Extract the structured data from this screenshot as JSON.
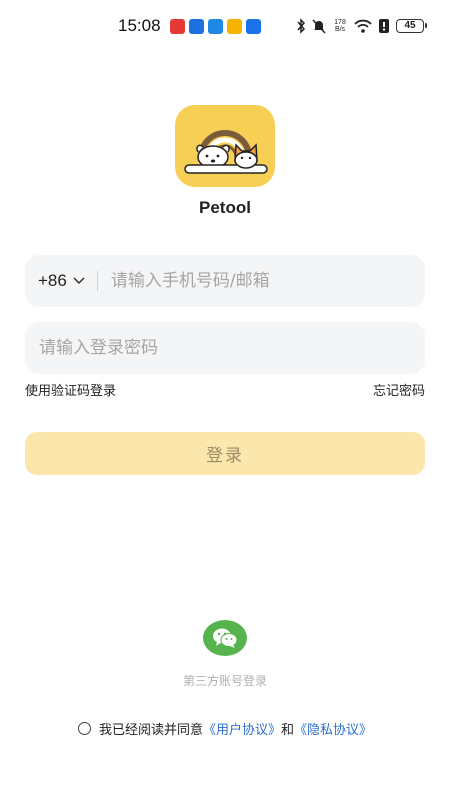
{
  "status_bar": {
    "time": "15:08",
    "net_speed_value": "178",
    "net_speed_unit": "B/s",
    "battery": "45",
    "app_icon_colors": [
      "#e53935",
      "#1e6fe0",
      "#1e88e5",
      "#f4b400",
      "#1a73e8"
    ]
  },
  "app": {
    "name": "Petool",
    "brand_color": "#f7cf55"
  },
  "login_form": {
    "country_code": "+86",
    "phone_placeholder": "请输入手机号码/邮箱",
    "password_placeholder": "请输入登录密码",
    "code_login_link": "使用验证码登录",
    "forgot_password_link": "忘记密码",
    "submit_label": "登录"
  },
  "third_party": {
    "label": "第三方账号登录",
    "wechat_color": "#57b34e"
  },
  "agreement": {
    "prefix": "我已经阅读并同意",
    "user_agreement": "《用户协议》",
    "conjunction": "和",
    "privacy_policy": "《隐私协议》"
  }
}
